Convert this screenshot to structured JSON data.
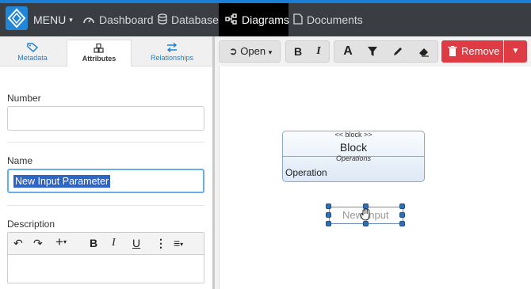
{
  "topnav": {
    "menu_label": "MENU",
    "dashboard_label": "Dashboard",
    "database_label": "Database",
    "diagrams_label": "Diagrams",
    "documents_label": "Documents"
  },
  "left_tabs": {
    "metadata": "Metadata",
    "attributes": "Attributes",
    "relationships": "Relationships",
    "active": "Attributes"
  },
  "form": {
    "number_label": "Number",
    "number_value": "",
    "name_label": "Name",
    "name_value": "New Input Parameter",
    "description_label": "Description"
  },
  "toolbar": {
    "open_label": "Open",
    "remove_label": "Remove"
  },
  "diagram": {
    "block_stereotype": "<< block >>",
    "block_name": "Block",
    "operations_header": "Operations",
    "operation_item": "Operation",
    "selected_element_text": "New Input"
  },
  "colors": {
    "accent": "#1a7fd4",
    "remove": "#de3b45",
    "topbar": "#3a3d42"
  }
}
